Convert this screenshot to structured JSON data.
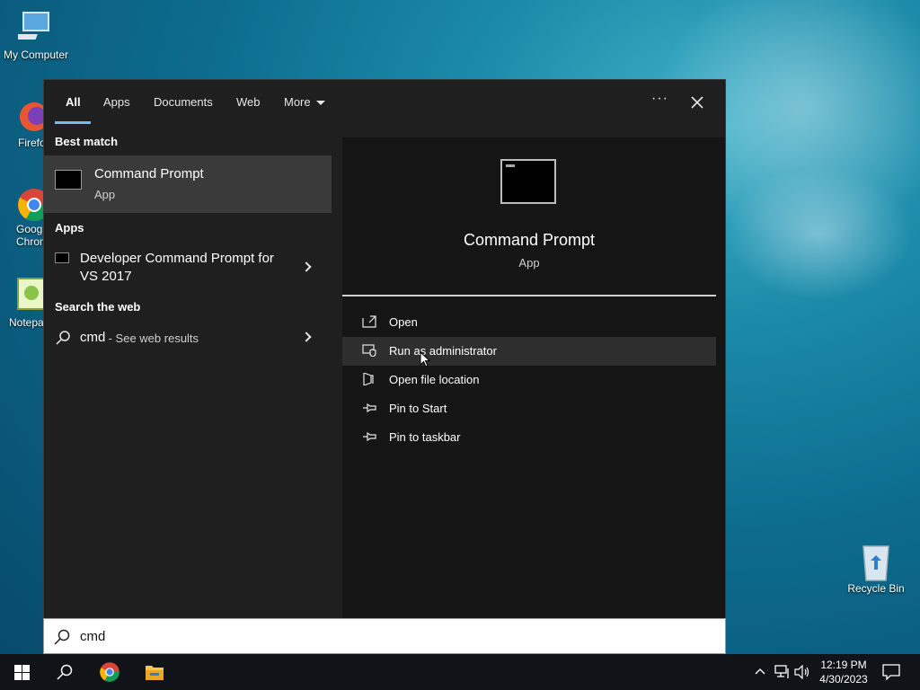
{
  "desktop": {
    "icons": [
      {
        "label": "My Computer"
      },
      {
        "label": "Firefo"
      },
      {
        "label_line1": "Goog",
        "label_line2": "Chron"
      },
      {
        "label": "Notepa"
      },
      {
        "label": "Recycle Bin"
      }
    ]
  },
  "start_menu": {
    "tabs": [
      "All",
      "Apps",
      "Documents",
      "Web",
      "More"
    ],
    "active_tab": "All",
    "sections": {
      "best_match": "Best match",
      "apps": "Apps",
      "search_web": "Search the web"
    },
    "best_match_item": {
      "title": "Command Prompt",
      "subtitle": "App"
    },
    "app_item": {
      "line1": "Developer Command Prompt for",
      "line2": "VS 2017"
    },
    "web_item": {
      "query": "cmd",
      "suffix": " - See web results"
    },
    "preview": {
      "title": "Command Prompt",
      "subtitle": "App"
    },
    "actions": [
      {
        "label": "Open",
        "icon": "open-icon"
      },
      {
        "label": "Run as administrator",
        "icon": "shield-icon",
        "highlighted": true
      },
      {
        "label": "Open file location",
        "icon": "file-location-icon"
      },
      {
        "label": "Pin to Start",
        "icon": "pin-icon"
      },
      {
        "label": "Pin to taskbar",
        "icon": "pin-icon"
      }
    ]
  },
  "search": {
    "value": "cmd"
  },
  "taskbar": {
    "time": "12:19 PM",
    "date": "4/30/2023"
  },
  "colors": {
    "accent": "#76b9ed",
    "menu_bg": "#1f1f1f",
    "preview_bg": "#151515"
  }
}
